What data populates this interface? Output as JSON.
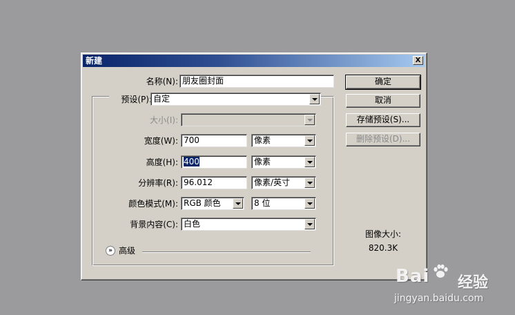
{
  "dialog": {
    "title": "新建",
    "close_label": "X"
  },
  "form": {
    "name_label": "名称(N):",
    "name_value": "朋友圈封面",
    "preset_label": "预设(P):",
    "preset_value": "自定",
    "size_label": "大小(I):",
    "size_value": "",
    "width_label": "宽度(W):",
    "width_value": "700",
    "width_unit": "像素",
    "height_label": "高度(H):",
    "height_value": "400",
    "height_unit": "像素",
    "resolution_label": "分辨率(R):",
    "resolution_value": "96.012",
    "resolution_unit": "像素/英寸",
    "color_mode_label": "颜色模式(M):",
    "color_mode_value": "RGB 颜色",
    "bit_depth_value": "8 位",
    "background_label": "背景内容(C):",
    "background_value": "白色",
    "advanced_label": "高级",
    "advanced_icon": "chevron-double-down-icon"
  },
  "buttons": {
    "ok": "确定",
    "cancel": "取消",
    "save_preset": "存储预设(S)...",
    "delete_preset": "删除预设(D)..."
  },
  "info": {
    "image_size_label": "图像大小:",
    "image_size_value": "820.3K"
  },
  "watermark": {
    "logo": "Bai",
    "logo_tail": "经验",
    "url": "jingyan.baidu.com"
  }
}
